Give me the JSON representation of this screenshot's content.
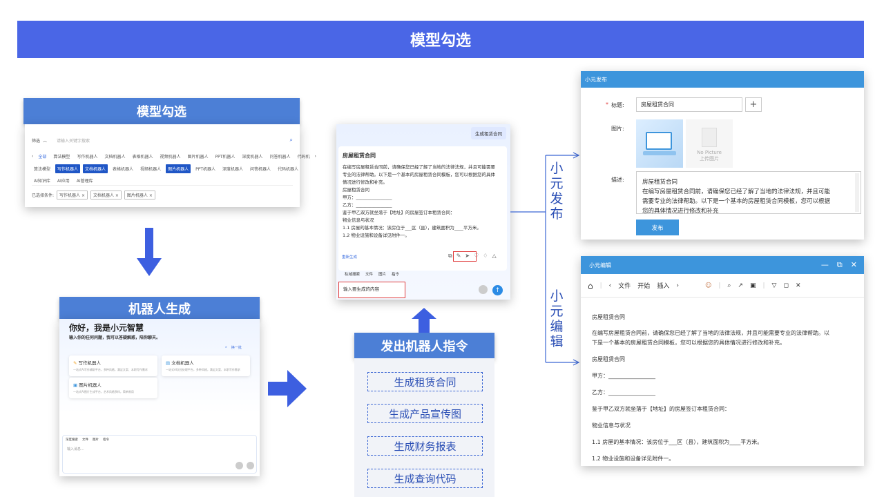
{
  "banner": {
    "title": "模型勾选"
  },
  "sections": {
    "model_select": "模型勾选",
    "robot_generate": "机器人生成",
    "send_command": "发出机器人指令"
  },
  "model_panel": {
    "filter_label": "筛选",
    "search_placeholder": "请输入关键字搜索",
    "row1": [
      "全部",
      "算法模型",
      "写作机器人",
      "文档机器人",
      "表格机器人",
      "视频机器人",
      "图片机器人",
      "PPT机器人",
      "深度机器人",
      "问答机器人",
      "代码机"
    ],
    "row2": [
      "算法模型",
      "写作机器人",
      "文档机器人",
      "表格机器人",
      "视频机器人",
      "图片机器人",
      "PPT机器人",
      "深度机器人",
      "问答机器人",
      "代码机器人"
    ],
    "row3": [
      "AI知识库",
      "AI应用",
      "AI管理库"
    ],
    "selected_label": "已选择条件:",
    "selected_tags": [
      "写作机器人 ×",
      "文档机器人 ×",
      "图片机器人 ×"
    ]
  },
  "robot_panel": {
    "greeting": "你好，我是小元智慧",
    "sub": "输入你的任何问题，我可以答疑解惑，陪你聊天。",
    "refresh": "换一批",
    "cards": [
      {
        "title": "写作机器人",
        "desc": "一站式AI写作辅助平台，多种风格，满足文案、本职写作需求"
      },
      {
        "title": "文档机器人",
        "desc": "一站式AI文档处理平台，多种风格，满足文案、本职写作需求"
      },
      {
        "title": "图片机器人",
        "desc": "一站式AI图片生成平台，艺术风格多样，简单易用"
      }
    ],
    "tools": [
      "深度搜索",
      "文件",
      "图片",
      "指令"
    ],
    "input_placeholder": "输入消息..."
  },
  "chat": {
    "user_msg": "生成租赁合同",
    "answer_title": "房屋租赁合同",
    "answer_lines": [
      "在编写房屋租赁合同前，请确保您已经了解了当地的法律法规，并且可能需要",
      "专业的法律帮助。以下是一个基本的房屋租赁合同模板，您可以根据您的具体",
      "情况进行修改和补充。",
      "房屋租赁合同",
      "甲方：________________",
      "乙方：________________",
      "鉴于甲乙双方就坐落于【地址】的房屋签订本租赁合同：",
      "物业信息与状况",
      "1.1 房屋的基本情况：该房位于___区（县），建筑面积为____平方米。",
      "1.2 物业设施和设备详见附件一。"
    ],
    "regenerate": "重新生成",
    "tools": [
      "私域搜索",
      "文件",
      "图片",
      "指令"
    ],
    "input_placeholder": "输入要生成的内容"
  },
  "commands": [
    "生成租赁合同",
    "生成产品宣传图",
    "生成财务报表",
    "生成查询代码"
  ],
  "labels": {
    "publish": [
      "小",
      "元",
      "发",
      "布"
    ],
    "edit": [
      "小",
      "元",
      "编",
      "辑"
    ]
  },
  "publish_dialog": {
    "title": "小元发布",
    "required_mark": "*",
    "title_label": "标题:",
    "title_value": "房屋租赁合同",
    "add": "+",
    "image_label": "图片:",
    "no_picture": "No Picture",
    "upload": "上传图片",
    "desc_label": "描述:",
    "desc_lines": [
      "房屋租赁合同",
      "在编写房屋租赁合同前，请确保您已经了解了当地的法律法规，并且可能",
      "需要专业的法律帮助。以下是一个基本的房屋租赁合同模板，您可以根据",
      "您的具体情况进行修改和补充"
    ],
    "button": "发布"
  },
  "edit_window": {
    "title": "小元编辑",
    "toolbar": [
      "文件",
      "开始",
      "插入"
    ],
    "doc_lines": [
      "房屋租赁合同",
      "在编写房屋租赁合同前，请确保您已经了解了当地的法律法规，并且可能需要专业的法律帮助。以",
      "下是一个基本的房屋租赁合同模板，您可以根据您的具体情况进行修改和补充。",
      "房屋租赁合同",
      "甲方：_________________",
      "乙方：_________________",
      "鉴于甲乙双方就坐落于【地址】的房屋签订本租赁合同：",
      "物业信息与状况",
      "1.1 房屋的基本情况：该房位于___区（县），建筑面积为____平方米。",
      "1.2 物业设施和设备详见附件一。"
    ]
  },
  "colors": {
    "accent": "#4a66e6",
    "header_blue": "#4c7fd6",
    "dialog_blue": "#3d95dc",
    "highlight_red": "#e03a3a"
  }
}
